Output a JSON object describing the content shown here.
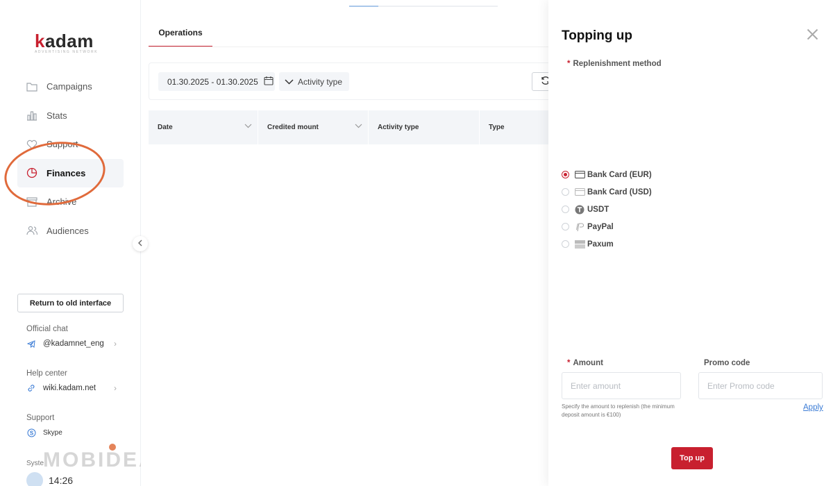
{
  "logo": {
    "k": "k",
    "rest": "adam",
    "tagline": "ADVERTISING NETWORK"
  },
  "sidebar": {
    "items": [
      {
        "label": "Campaigns",
        "icon": "folder-icon"
      },
      {
        "label": "Stats",
        "icon": "bar-chart-icon"
      },
      {
        "label": "Support",
        "icon": "heart-icon"
      },
      {
        "label": "Finances",
        "icon": "pie-chart-icon",
        "active": true
      },
      {
        "label": "Archive",
        "icon": "archive-icon"
      },
      {
        "label": "Audiences",
        "icon": "users-icon"
      }
    ],
    "old_interface_label": "Return to old interface",
    "official_chat": {
      "label": "Official chat",
      "value": "@kadamnet_eng"
    },
    "help_center": {
      "label": "Help center",
      "value": "wiki.kadam.net"
    },
    "support": {
      "label": "Support",
      "value": "Skype"
    },
    "system": {
      "label": "Syste",
      "time": "14:26"
    },
    "watermark": "MOBIDEA"
  },
  "main": {
    "tab_label": "Operations",
    "date_range": "01.30.2025 - 01.30.2025",
    "activity_filter": "Activity type",
    "table_headers": [
      "Date",
      "Credited mount",
      "Activity type",
      "Type"
    ]
  },
  "drawer": {
    "title": "Topping up",
    "method_label": "Replenishment method",
    "methods": [
      {
        "label": "Bank Card (EUR)",
        "icon": "card-icon",
        "selected": true
      },
      {
        "label": "Bank Card (USD)",
        "icon": "card-icon",
        "selected": false
      },
      {
        "label": "USDT",
        "icon": "tether-icon",
        "selected": false
      },
      {
        "label": "PayPal",
        "icon": "paypal-icon",
        "selected": false
      },
      {
        "label": "Paxum",
        "icon": "paxum-icon",
        "selected": false
      }
    ],
    "amount_label": "Amount",
    "amount_placeholder": "Enter amount",
    "amount_hint": "Specify the amount to replenish (the minimum deposit amount is €100)",
    "promo_label": "Promo code",
    "promo_placeholder": "Enter Promo code",
    "apply_label": "Apply",
    "submit_label": "Top up"
  },
  "colors": {
    "accent": "#c8202f",
    "link": "#3a7bd5",
    "annotation": "#e06a3b"
  }
}
